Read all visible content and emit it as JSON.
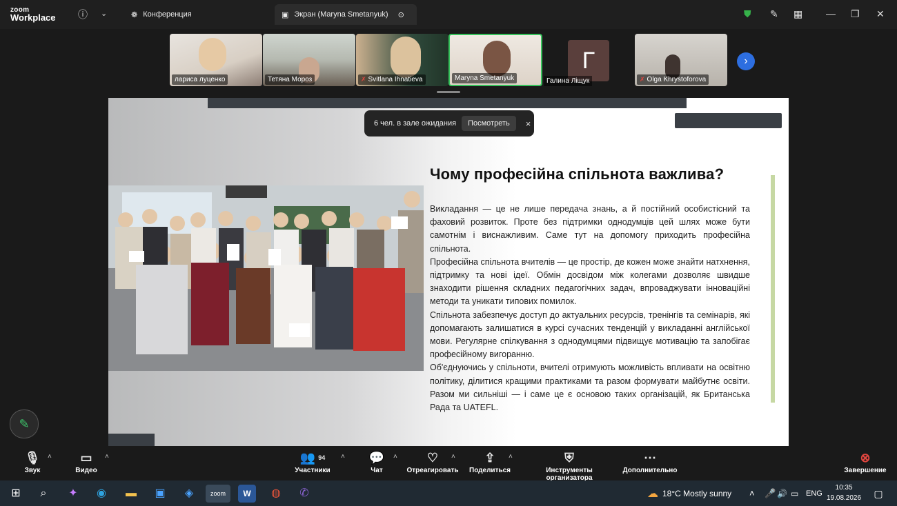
{
  "app": {
    "brand_top": "zoom",
    "brand_bottom": "Workplace"
  },
  "tabs": [
    {
      "label": "Конференция"
    },
    {
      "label": "Экран (Maryna Smetanyuk)"
    }
  ],
  "participants": [
    {
      "name": "лариса луценко",
      "muted": false
    },
    {
      "name": "Тетяна Мороз",
      "muted": false
    },
    {
      "name": "Svitlana Ihnatieva",
      "muted": true
    },
    {
      "name": "Maryna Smetanyuk",
      "muted": false
    },
    {
      "name": "Галина Ліщук",
      "muted": false,
      "initial": "Г"
    },
    {
      "name": "Olga Khrystoforova",
      "muted": true
    }
  ],
  "waiting_room": {
    "text": "6 чел. в зале ожидания",
    "button": "Посмотреть",
    "close": "×"
  },
  "slide": {
    "title": "Чому професійна спільнота важлива?",
    "paragraphs": [
      "Викладання — це не лише передача знань, а й постійний особистісний та фаховий розвиток. Проте без підтримки однодумців цей шлях може бути самотнім і виснажливим. Саме тут на допомогу приходить професійна спільнота.",
      "Професійна спільнота вчителів — це простір, де кожен може знайти натхнення, підтримку та нові ідеї. Обмін досвідом між колегами дозволяє швидше знаходити рішення складних педагогічних задач, впроваджувати інноваційні методи та уникати типових помилок.",
      "Спільнота забезпечує доступ до актуальних ресурсів, тренінгів та семінарів, які допомагають залишатися в курсі сучасних тенденцій у викладанні англійської мови. Регулярне спілкування з однодумцями підвищує мотивацію та запобігає професійному вигоранню.",
      "Об'єднуючись у спільноти, вчителі отримують можливість впливати на освітню політику, ділитися кращими практиками та разом формувати майбутнє освіти. Разом ми сильніші — і саме це є основою таких організацій, як Британська Рада та UATEFL."
    ]
  },
  "controls": {
    "audio": "Звук",
    "video": "Видео",
    "participants": "Участники",
    "participants_count": "94",
    "chat": "Чат",
    "react": "Отреагировать",
    "share": "Поделиться",
    "host_tools": "Инструменты организатора",
    "more": "Дополнительно",
    "end": "Завершение"
  },
  "taskbar": {
    "weather": "18°C  Mostly sunny",
    "lang": "ENG",
    "time": "10:35",
    "date": "19.08.2026"
  }
}
